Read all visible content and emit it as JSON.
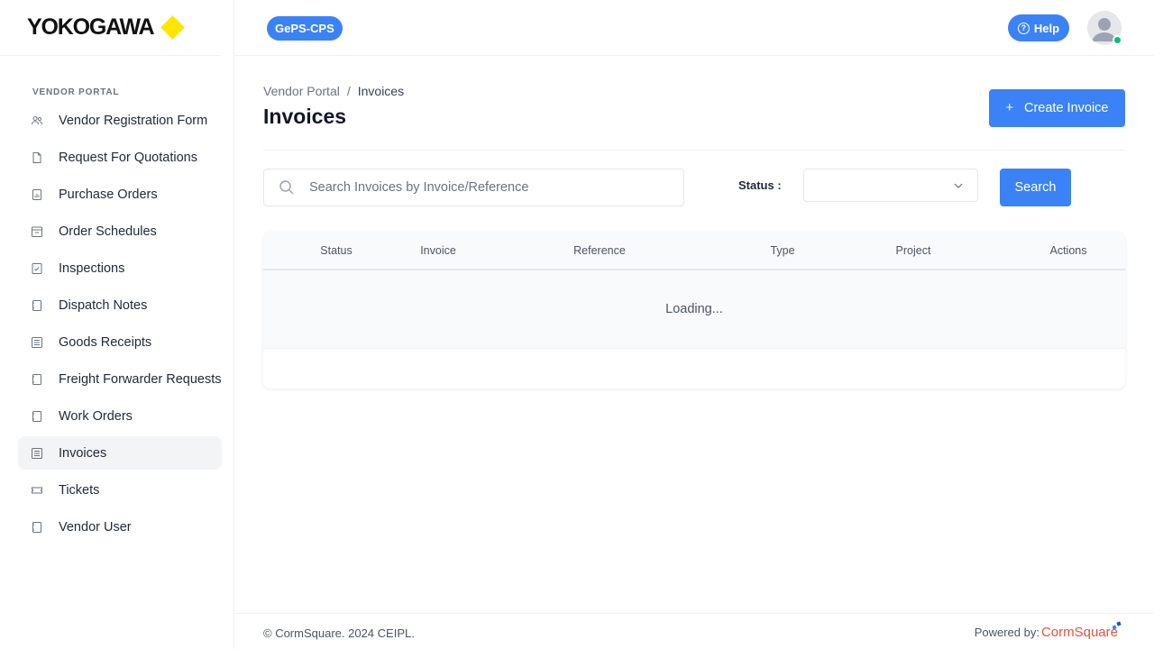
{
  "brand": {
    "logo_text": "YOKOGAWA",
    "accent": "#ffe600"
  },
  "sidebar": {
    "section_label": "VENDOR PORTAL",
    "items": [
      {
        "label": "Vendor Registration Form",
        "icon": "users-icon",
        "active": false
      },
      {
        "label": "Request For Quotations",
        "icon": "document-icon",
        "active": false
      },
      {
        "label": "Purchase Orders",
        "icon": "chart-file-icon",
        "active": false
      },
      {
        "label": "Order Schedules",
        "icon": "calendar-icon",
        "active": false
      },
      {
        "label": "Inspections",
        "icon": "checklist-icon",
        "active": false
      },
      {
        "label": "Dispatch Notes",
        "icon": "page-icon",
        "active": false
      },
      {
        "label": "Goods Receipts",
        "icon": "list-icon",
        "active": false
      },
      {
        "label": "Freight Forwarder Requests",
        "icon": "page-icon",
        "active": false
      },
      {
        "label": "Work Orders",
        "icon": "page-icon",
        "active": false
      },
      {
        "label": "Invoices",
        "icon": "list-icon",
        "active": true
      },
      {
        "label": "Tickets",
        "icon": "ticket-icon",
        "active": false
      },
      {
        "label": "Vendor User",
        "icon": "page-icon",
        "active": false
      }
    ]
  },
  "topbar": {
    "app_badge": "GePS-CPS",
    "help_label": "Help",
    "help_icon": "?",
    "status_color": "#10b981"
  },
  "main": {
    "breadcrumb": {
      "root": "Vendor Portal",
      "separator": "/",
      "current": "Invoices"
    },
    "title": "Invoices",
    "create_button": {
      "icon": "+",
      "label": "Create Invoice"
    },
    "search": {
      "placeholder": "Search Invoices by Invoice/Reference",
      "value": ""
    },
    "status_filter": {
      "label": "Status :",
      "value": ""
    },
    "search_button": "Search",
    "table": {
      "columns": [
        "Status",
        "Invoice",
        "Reference",
        "Type",
        "Project",
        "Actions"
      ],
      "loading_text": "Loading..."
    }
  },
  "footer": {
    "copyright": "© CormSquare. 2024 CEIPL.",
    "powered_label": "Powered by:",
    "powered_brand": "CormSquare"
  },
  "colors": {
    "primary": "#3b82f6",
    "brand_red": "#e5533d"
  }
}
